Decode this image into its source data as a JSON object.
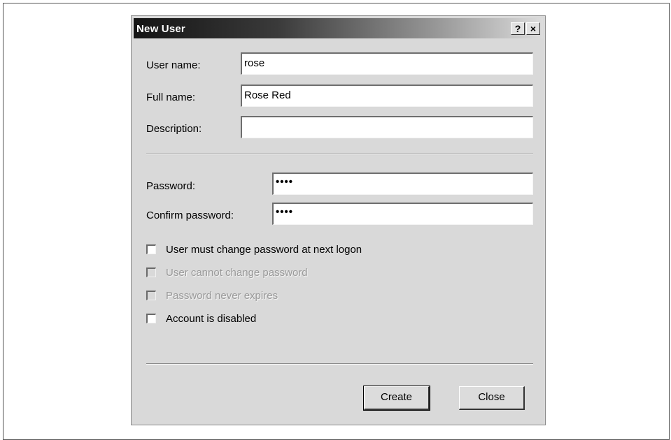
{
  "dialog": {
    "title": "New User",
    "help_button": "?",
    "close_button": "×"
  },
  "form": {
    "user_name_label": "User name:",
    "user_name_value": "rose",
    "full_name_label": "Full name:",
    "full_name_value": "Rose Red",
    "description_label": "Description:",
    "description_value": "",
    "password_label": "Password:",
    "password_value": "••••",
    "confirm_password_label": "Confirm password:",
    "confirm_password_value": "••••"
  },
  "options": [
    {
      "label": "User must change password at next logon",
      "checked": false,
      "enabled": true
    },
    {
      "label": "User cannot change password",
      "checked": false,
      "enabled": false
    },
    {
      "label": "Password never expires",
      "checked": false,
      "enabled": false
    },
    {
      "label": "Account is disabled",
      "checked": false,
      "enabled": true
    }
  ],
  "buttons": {
    "create_label": "Create",
    "close_label": "Close"
  }
}
